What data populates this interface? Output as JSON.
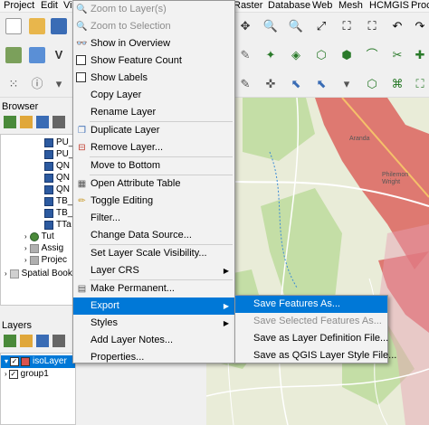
{
  "menubar": {
    "left_items": [
      "Project",
      "Edit",
      "Vi"
    ],
    "right_items": [
      "Raster",
      "Database",
      "Web",
      "Mesh",
      "HCMGIS",
      "Proc"
    ]
  },
  "browser_panel": {
    "title": "Browser",
    "items": [
      {
        "label": "PU_",
        "icon": "raster-layer-icon"
      },
      {
        "label": "PU_",
        "icon": "raster-layer-icon"
      },
      {
        "label": "QN",
        "icon": "raster-layer-icon"
      },
      {
        "label": "QN",
        "icon": "raster-layer-icon"
      },
      {
        "label": "QN",
        "icon": "raster-layer-icon"
      },
      {
        "label": "TB_",
        "icon": "raster-layer-icon"
      },
      {
        "label": "TB_",
        "icon": "raster-layer-icon"
      },
      {
        "label": "TTa",
        "icon": "raster-layer-icon"
      },
      {
        "label": "Tut",
        "icon": "qgis-q-icon"
      },
      {
        "label": "Assig",
        "icon": "database-icon"
      },
      {
        "label": "Projec",
        "icon": "database-icon"
      },
      {
        "label": "Spatial Book",
        "icon": "bookmark-icon"
      }
    ]
  },
  "layers_panel": {
    "title": "Layers",
    "items": [
      {
        "label": "isoLayer",
        "checked": true,
        "selected": true
      },
      {
        "label": "group1",
        "checked": true,
        "selected": false
      }
    ]
  },
  "context_menu": {
    "items": [
      {
        "label": "Zoom to Layer(s)",
        "u_index": 0,
        "disabled": true,
        "icon": "zoom-to-layer-icon"
      },
      {
        "label": "Zoom to Selection",
        "u_index": 8,
        "disabled": true,
        "icon": "zoom-to-selection-icon"
      },
      {
        "label": "Show in Overview",
        "u_index": 5,
        "disabled": false,
        "icon": "overview-icon"
      },
      {
        "label": "Show Feature Count",
        "u_index": null,
        "disabled": false,
        "icon": "checkbox-icon"
      },
      {
        "label": "Show Labels",
        "u_index": null,
        "disabled": false,
        "icon": "checkbox-icon"
      },
      {
        "label": "Copy Layer",
        "u_index": null,
        "disabled": false,
        "icon": ""
      },
      {
        "label": "Rename Layer",
        "u_index": null,
        "disabled": false,
        "icon": ""
      },
      {
        "label": "Duplicate Layer",
        "u_index": 0,
        "disabled": false,
        "icon": "duplicate-icon"
      },
      {
        "label": "Remove Layer...",
        "u_index": 0,
        "disabled": false,
        "icon": "remove-layer-icon"
      },
      {
        "label": "Move to Bottom",
        "u_index": null,
        "disabled": false,
        "icon": ""
      },
      {
        "label": "Open Attribute Table",
        "u_index": 5,
        "disabled": false,
        "icon": "attribute-table-icon"
      },
      {
        "label": "Toggle Editing",
        "u_index": null,
        "disabled": false,
        "icon": "pencil-icon"
      },
      {
        "label": "Filter...",
        "u_index": 0,
        "disabled": false,
        "icon": ""
      },
      {
        "label": "Change Data Source...",
        "u_index": 0,
        "disabled": false,
        "icon": ""
      },
      {
        "label": "Set Layer Scale Visibility...",
        "u_index": null,
        "disabled": false,
        "icon": ""
      },
      {
        "label": "Layer CRS",
        "u_index": null,
        "disabled": false,
        "icon": "",
        "submenu": true
      },
      {
        "label": "Make Permanent...",
        "u_index": null,
        "disabled": false,
        "icon": "make-permanent-icon"
      },
      {
        "label": "Export",
        "u_index": null,
        "disabled": false,
        "icon": "",
        "submenu": true,
        "highlight": true
      },
      {
        "label": "Styles",
        "u_index": null,
        "disabled": false,
        "icon": "",
        "submenu": true
      },
      {
        "label": "Add Layer Notes...",
        "u_index": null,
        "disabled": false,
        "icon": ""
      },
      {
        "label": "Properties...",
        "u_index": 0,
        "disabled": false,
        "icon": ""
      }
    ]
  },
  "export_submenu": {
    "items": [
      {
        "label": "Save Features As...",
        "highlight": true,
        "disabled": false
      },
      {
        "label": "Save Selected Features As...",
        "highlight": false,
        "disabled": true
      },
      {
        "label": "Save as Layer Definition File...",
        "highlight": false,
        "disabled": false
      },
      {
        "label": "Save as QGIS Layer Style File...",
        "highlight": false,
        "disabled": false
      }
    ]
  },
  "map_labels": {
    "label1": "Aranda",
    "label2": "Philemon Wright"
  },
  "colors": {
    "accent": "#0078d7",
    "menu_bg": "#f2f2f2",
    "isochrone_red": "#d9534f",
    "map_green": "#b7d89a"
  }
}
